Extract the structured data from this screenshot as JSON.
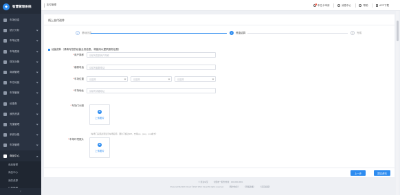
{
  "sidebar": {
    "brand": "智慧管理系统",
    "items": [
      {
        "label": "车场信息"
      },
      {
        "label": "统计分析"
      },
      {
        "label": "车场记录"
      },
      {
        "label": "车场费用"
      },
      {
        "label": "财务对账"
      },
      {
        "label": "商铺管理"
      },
      {
        "label": "车位地锁"
      },
      {
        "label": "车场管家"
      },
      {
        "label": "优惠券"
      },
      {
        "label": "我的资源"
      },
      {
        "label": "充值管理"
      },
      {
        "label": "系统功能"
      },
      {
        "label": "车场管理"
      },
      {
        "label": "商品中心"
      }
    ],
    "sub_items": [
      {
        "label": "商品管理"
      },
      {
        "label": "商品中心"
      },
      {
        "label": "我的资源"
      },
      {
        "label": "订单管理"
      },
      {
        "label": ""
      }
    ],
    "collapse_icon": "chevron-left-icon"
  },
  "header": {
    "breadcrumb": "支付管理",
    "actions": [
      {
        "label": "车位卡申请",
        "icon": "bell-icon",
        "badge": "8"
      },
      {
        "label": "消息中心",
        "icon": "message-icon"
      },
      {
        "label": "帮助",
        "icon": "help-icon"
      },
      {
        "label": "APP下载",
        "icon": "phone-icon"
      }
    ]
  },
  "page": {
    "title": "线上支付进件",
    "steps": [
      {
        "label": "基础信息",
        "num": "1",
        "state": "done"
      },
      {
        "label": "资金结算",
        "num": "2",
        "state": "active"
      },
      {
        "label": "完成",
        "num": "3",
        "state": "pending"
      }
    ],
    "section_title": "经营资料（请填写您的经营业务信息，将被用以提供服务信息）",
    "fields": [
      {
        "label": "商户简称",
        "required": true,
        "placeholder": "请填写您的商户简称"
      },
      {
        "label": "客服电话",
        "required": true,
        "placeholder": "请填写客服电话"
      },
      {
        "label": "车场位置",
        "required": true,
        "selects": [
          "请选择",
          "请选择",
          "请选择"
        ]
      },
      {
        "label": "车场地址",
        "required": true,
        "placeholder": "请填写详细地址"
      }
    ],
    "uploads": [
      {
        "label": "车场门头照",
        "required": true,
        "text": "上传图片"
      },
      {
        "label": "车场环境照片",
        "required": true,
        "text": "上传图片"
      }
    ],
    "upload_hint": "（车场门头照必须显示车场名称，图片不超过2M，支持jpg、jpeg、png格式）",
    "buttons": {
      "prev": "上一步",
      "submit": "提交资料"
    }
  },
  "footer": {
    "line1": [
      "© 慧泊车宝",
      "全国统一服务热线：400-060-0601"
    ],
    "line2": [
      "Powered By Wish Cloud ©2024 Wish Cloud All rights reserved.",
      "《用户协议》",
      "《隐私政策》",
      "《意见反馈》"
    ]
  },
  "colors": {
    "accent": "#2d8cf0",
    "sidebar_bg": "#2a3342",
    "required": "#f04d3a"
  }
}
